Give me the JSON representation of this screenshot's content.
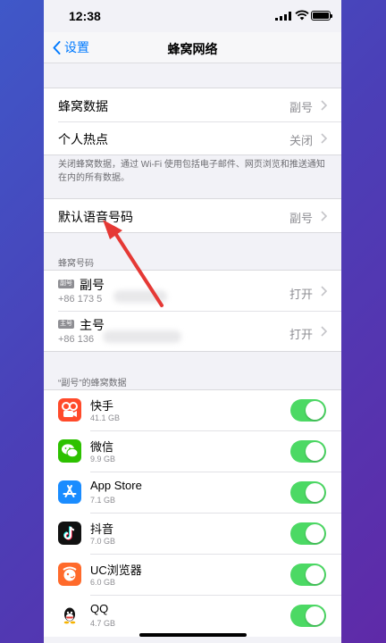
{
  "status": {
    "time": "12:38"
  },
  "nav": {
    "back_label": "设置",
    "title": "蜂窝网络"
  },
  "group1": [
    {
      "label": "蜂窝数据",
      "value": "副号"
    },
    {
      "label": "个人热点",
      "value": "关闭"
    }
  ],
  "group1_note": "关闭蜂窝数据，通过 Wi-Fi 使用包括电子邮件、网页浏览和推送通知在内的所有数据。",
  "default_voice": {
    "label": "默认语音号码",
    "value": "副号"
  },
  "sims_header": "蜂窝号码",
  "sims": [
    {
      "badge": "副号",
      "name": "副号",
      "number": "+86 173 5",
      "status": "打开"
    },
    {
      "badge": "主号",
      "name": "主号",
      "number": "+86 136",
      "status": "打开"
    }
  ],
  "apps_header": "“副号”的蜂窝数据",
  "apps": [
    {
      "name": "快手",
      "size": "41.1 GB",
      "icon": "kuaishou-icon",
      "enabled": true
    },
    {
      "name": "微信",
      "size": "9.9 GB",
      "icon": "wechat-icon",
      "enabled": true
    },
    {
      "name": "App Store",
      "size": "7.1 GB",
      "icon": "app-store-icon",
      "enabled": true
    },
    {
      "name": "抖音",
      "size": "7.0 GB",
      "icon": "douyin-icon",
      "enabled": true
    },
    {
      "name": "UC浏览器",
      "size": "6.0 GB",
      "icon": "uc-browser-icon",
      "enabled": true
    },
    {
      "name": "QQ",
      "size": "4.7 GB",
      "icon": "qq-icon",
      "enabled": true
    }
  ],
  "colors": {
    "accent": "#007aff",
    "toggle_on": "#4cd964",
    "annotation_arrow": "#e53935"
  }
}
